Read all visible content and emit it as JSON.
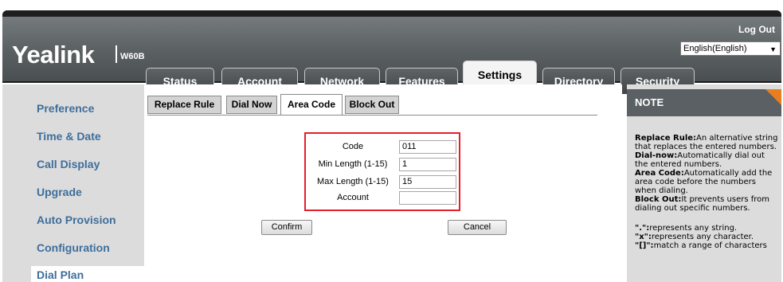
{
  "header": {
    "logo": "Yealink",
    "model": "W60B",
    "logout": "Log Out",
    "language": "English(English)"
  },
  "tabs": [
    {
      "label": "Status"
    },
    {
      "label": "Account"
    },
    {
      "label": "Network"
    },
    {
      "label": "Features"
    },
    {
      "label": "Settings",
      "active": true
    },
    {
      "label": "Directory"
    },
    {
      "label": "Security"
    }
  ],
  "sidebar": {
    "items": [
      {
        "label": "Preference"
      },
      {
        "label": "Time & Date"
      },
      {
        "label": "Call Display"
      },
      {
        "label": "Upgrade"
      },
      {
        "label": "Auto Provision"
      },
      {
        "label": "Configuration"
      },
      {
        "label": "Dial Plan",
        "active": true
      }
    ]
  },
  "subtabs": [
    {
      "label": "Replace Rule"
    },
    {
      "label": "Dial Now"
    },
    {
      "label": "Area Code",
      "active": true
    },
    {
      "label": "Block Out"
    }
  ],
  "form": {
    "code_label": "Code",
    "code_value": "011",
    "min_label": "Min Length (1-15)",
    "min_value": "1",
    "max_label": "Max Length (1-15)",
    "max_value": "15",
    "account_label": "Account",
    "account_value": ""
  },
  "buttons": {
    "confirm": "Confirm",
    "cancel": "Cancel"
  },
  "note": {
    "title": "NOTE",
    "replace_rule_term": "Replace Rule:",
    "replace_rule_text": "An alternative string that replaces the entered numbers.",
    "dial_now_term": "Dial-now:",
    "dial_now_text": "Automatically dial out the entered numbers.",
    "area_code_term": "Area Code:",
    "area_code_text": "Automatically add the area code before the numbers when dialing.",
    "block_out_term": "Block Out:",
    "block_out_text": "It prevents users from dialing out specific numbers.",
    "dot_term": "\".\":",
    "dot_text": "represents any string.",
    "x_term": "\"x\":",
    "x_text": "represents any character.",
    "range_term": "\"[]\":",
    "range_text": "match a range of characters"
  },
  "colors": {
    "header_bg": "#5c6164",
    "sidebar_link": "#3e6e9c",
    "highlight_border": "#e4202a",
    "note_corner": "#e87e1e"
  }
}
